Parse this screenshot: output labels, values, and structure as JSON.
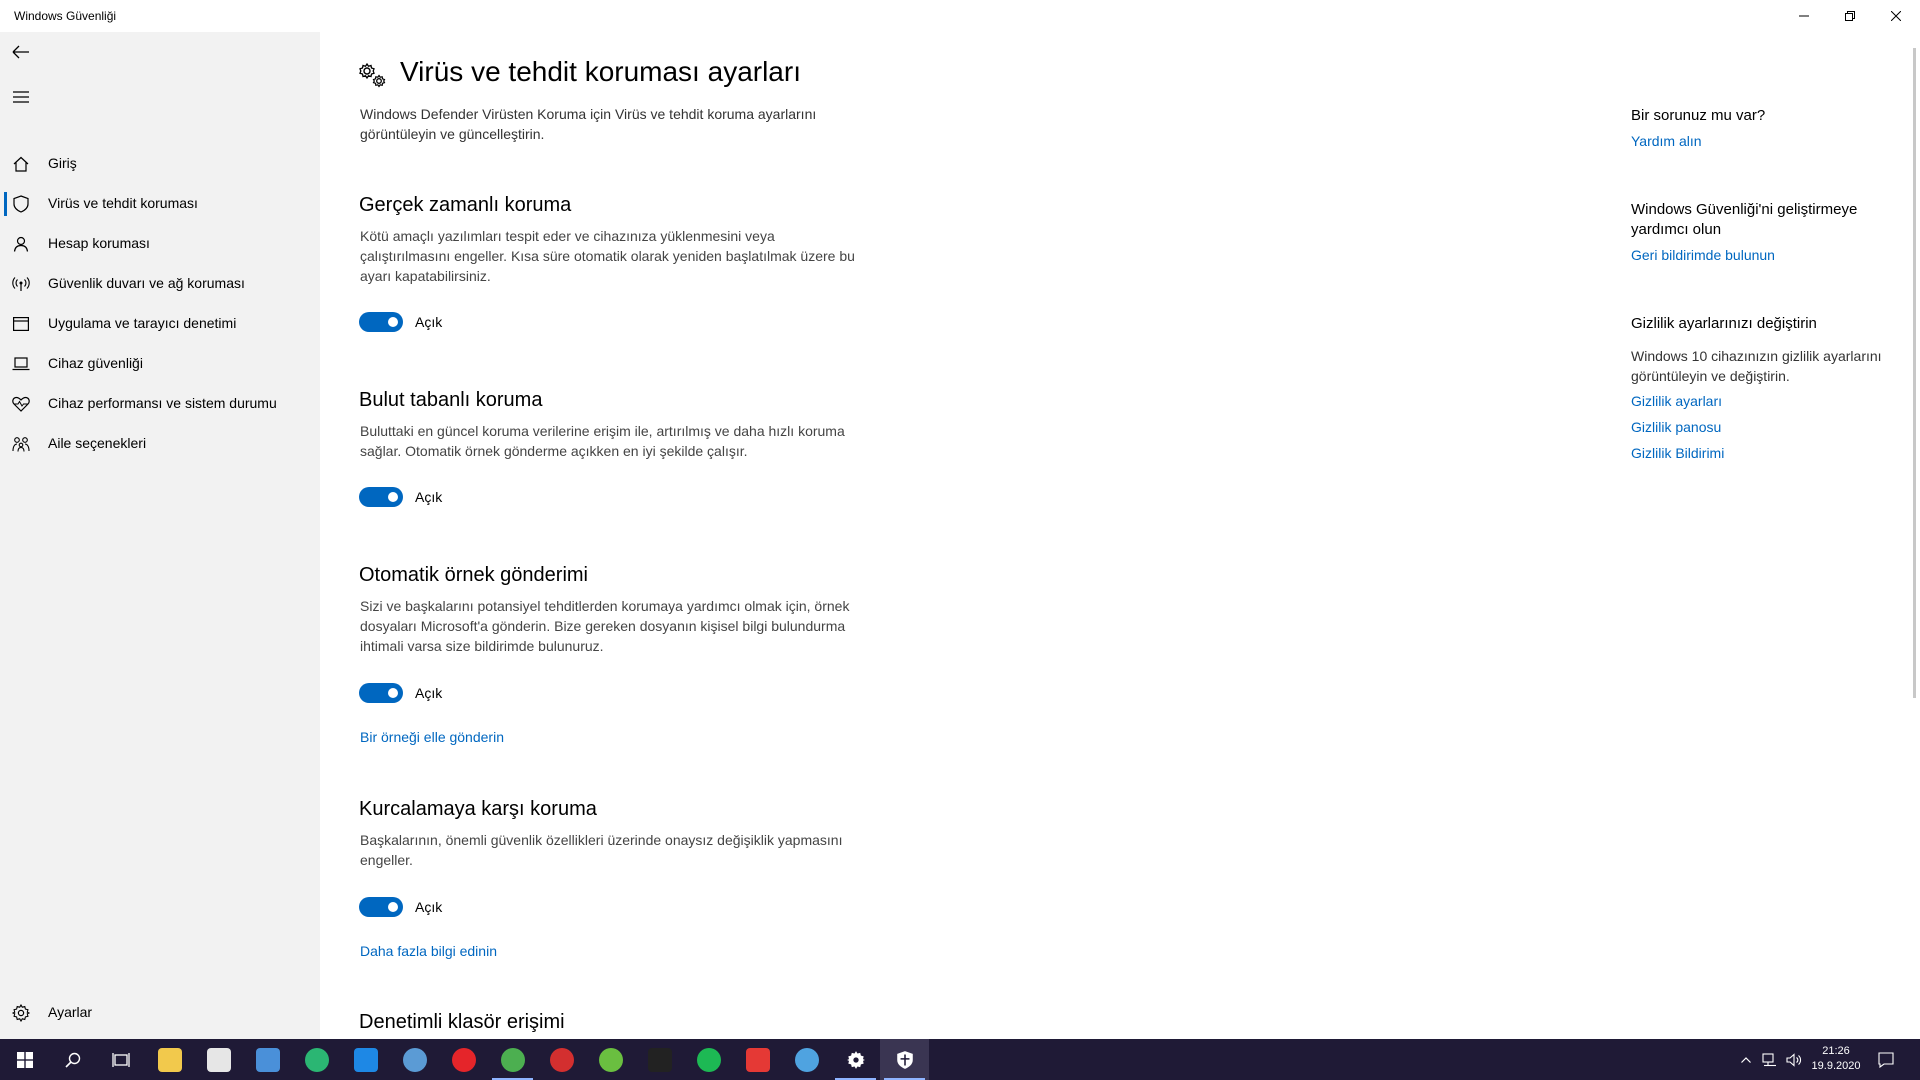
{
  "window": {
    "title": "Windows Güvenliği"
  },
  "sidebar": {
    "items": [
      {
        "label": "Giriş",
        "icon": "home-icon"
      },
      {
        "label": "Virüs ve tehdit koruması",
        "icon": "shield-icon",
        "active": true
      },
      {
        "label": "Hesap koruması",
        "icon": "person-icon"
      },
      {
        "label": "Güvenlik duvarı ve ağ koruması",
        "icon": "wifi-antenna-icon"
      },
      {
        "label": "Uygulama ve tarayıcı denetimi",
        "icon": "browser-window-icon"
      },
      {
        "label": "Cihaz güvenliği",
        "icon": "laptop-icon"
      },
      {
        "label": "Cihaz performansı ve sistem durumu",
        "icon": "heart-icon"
      },
      {
        "label": "Aile seçenekleri",
        "icon": "family-icon"
      }
    ],
    "settings_label": "Ayarlar"
  },
  "main": {
    "title": "Virüs ve tehdit koruması ayarları",
    "description": "Windows Defender Virüsten Koruma için Virüs ve tehdit koruma ayarlarını görüntüleyin ve güncelleştirin.",
    "sections": [
      {
        "title": "Gerçek zamanlı koruma",
        "description": "Kötü amaçlı yazılımları tespit eder ve cihazınıza yüklenmesini veya çalıştırılmasını engeller. Kısa süre otomatik olarak yeniden başlatılmak üzere bu ayarı kapatabilirsiniz.",
        "toggle_label": "Açık",
        "toggle_on": true
      },
      {
        "title": "Bulut tabanlı koruma",
        "description": "Buluttaki en güncel koruma verilerine erişim ile, artırılmış ve daha hızlı koruma sağlar. Otomatik örnek gönderme açıkken en iyi şekilde çalışır.",
        "toggle_label": "Açık",
        "toggle_on": true
      },
      {
        "title": "Otomatik örnek gönderimi",
        "description": "Sizi ve başkalarını potansiyel tehditlerden korumaya yardımcı olmak için, örnek dosyaları Microsoft'a gönderin. Bize gereken dosyanın kişisel bilgi bulundurma ihtimali varsa size bildirimde bulunuruz.",
        "toggle_label": "Açık",
        "toggle_on": true,
        "link": "Bir örneği elle gönderin"
      },
      {
        "title": "Kurcalamaya karşı koruma",
        "description": "Başkalarının, önemli güvenlik özellikleri üzerinde onaysız değişiklik yapmasını engeller.",
        "toggle_label": "Açık",
        "toggle_on": true,
        "link": "Daha fazla bilgi edinin"
      },
      {
        "title": "Denetimli klasör erişimi"
      }
    ]
  },
  "right_panel": {
    "help_title": "Bir sorunuz mu var?",
    "help_link": "Yardım alın",
    "improve_title": "Windows Güvenliği'ni geliştirmeye yardımcı olun",
    "improve_link": "Geri bildirimde bulunun",
    "privacy_title": "Gizlilik ayarlarınızı değiştirin",
    "privacy_text": "Windows 10 cihazınızın gizlilik ayarlarını görüntüleyin ve değiştirin.",
    "privacy_links": [
      "Gizlilik ayarları",
      "Gizlilik panosu",
      "Gizlilik Bildirimi"
    ]
  },
  "taskbar": {
    "apps": [
      {
        "name": "file-explorer-icon",
        "color": "#f2c94c"
      },
      {
        "name": "store-icon",
        "color": "#e6e6e6"
      },
      {
        "name": "remote-desktop-icon",
        "color": "#4a90d9"
      },
      {
        "name": "edge-icon",
        "color": "#2bb673"
      },
      {
        "name": "mail-icon",
        "color": "#1e88e5"
      },
      {
        "name": "steam-icon",
        "color": "#5b9bd5"
      },
      {
        "name": "opera-icon",
        "color": "#e5252a"
      },
      {
        "name": "chrome-icon",
        "color": "#4caf50"
      },
      {
        "name": "ccleaner-icon",
        "color": "#d32f2f"
      },
      {
        "name": "xbox-icon",
        "color": "#6abf40"
      },
      {
        "name": "epic-games-icon",
        "color": "#222222"
      },
      {
        "name": "spotify-icon",
        "color": "#1db954"
      },
      {
        "name": "lightning-app-icon",
        "color": "#e53935"
      },
      {
        "name": "steam-client-icon",
        "color": "#4fa3e0"
      },
      {
        "name": "settings-icon",
        "color": "#ffffff"
      },
      {
        "name": "windows-security-icon",
        "color": "#ffffff"
      }
    ],
    "time": "21:26",
    "date": "19.9.2020",
    "accent": "#0067c0"
  }
}
